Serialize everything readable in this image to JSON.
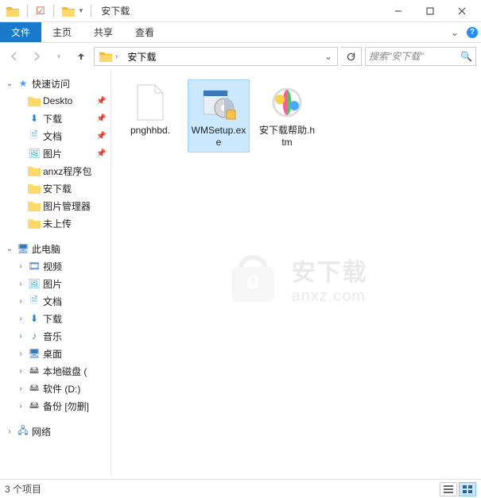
{
  "titlebar": {
    "title": "安下载"
  },
  "ribbon": {
    "tabs": {
      "file": "文件",
      "home": "主页",
      "share": "共享",
      "view": "查看"
    }
  },
  "address": {
    "crumb1": "安下载"
  },
  "search": {
    "placeholder": "搜索\"安下载\""
  },
  "tree": {
    "quick_access": "快速访问",
    "desktop": "Deskto",
    "downloads": "下载",
    "documents": "文档",
    "pictures": "图片",
    "anxz": "anxz程序包",
    "anxiazai": "安下载",
    "tupian_mgr": "图片管理器",
    "weishangchuan": "未上传",
    "this_pc": "此电脑",
    "videos": "视频",
    "pictures2": "图片",
    "documents2": "文档",
    "downloads2": "下载",
    "music": "音乐",
    "desktop2": "桌面",
    "local_disk": "本地磁盘 (",
    "drive_d": "软件 (D:)",
    "backup": "备份 [勿删]",
    "network": "网络"
  },
  "content": {
    "items": [
      {
        "name": "pnghhbd."
      },
      {
        "name": "WMSetup.exe"
      },
      {
        "name": "安下载帮助.htm"
      }
    ]
  },
  "status": {
    "count": "3 个项目"
  },
  "watermark": {
    "cn": "安下载",
    "en": "anxz.com"
  }
}
